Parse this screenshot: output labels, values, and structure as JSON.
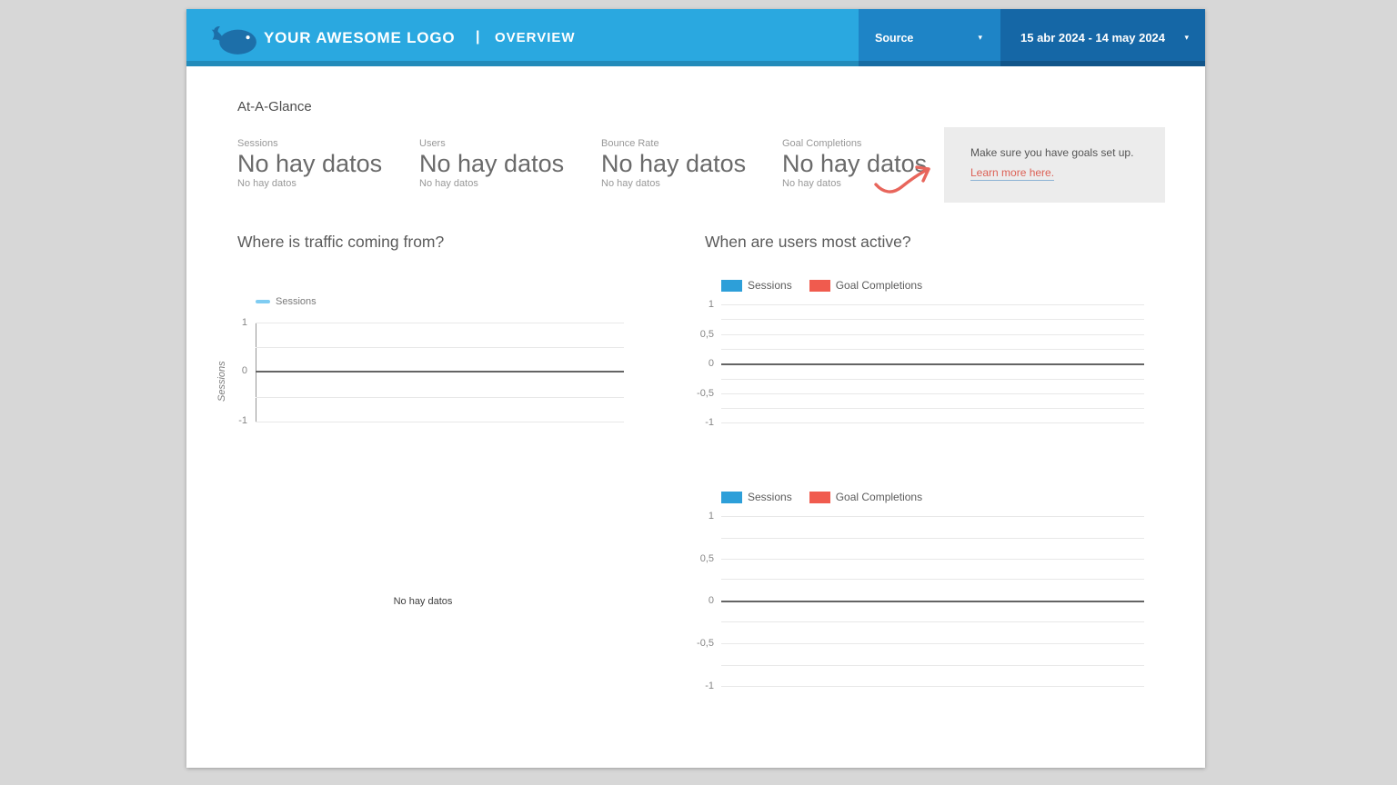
{
  "page": {
    "background_color": "#d7d7d7",
    "card_color": "#ffffff"
  },
  "header": {
    "logo_text": "YOUR AWESOME LOGO",
    "separator": "|",
    "page_title": "OVERVIEW",
    "source_filter": {
      "label": "Source",
      "caret": "▾"
    },
    "date_range": {
      "value": "15 abr 2024 - 14 may 2024",
      "caret": "▾"
    },
    "colors": {
      "bar": "#2aa8e0",
      "source_bg": "#1e84c6",
      "date_bg": "#1567a6",
      "logo": "#1d6fa9"
    }
  },
  "at_a_glance": {
    "title": "At-A-Glance",
    "metrics": [
      {
        "label": "Sessions",
        "value": "No hay datos",
        "sub": "No hay datos"
      },
      {
        "label": "Users",
        "value": "No hay datos",
        "sub": "No hay datos"
      },
      {
        "label": "Bounce Rate",
        "value": "No hay datos",
        "sub": "No hay datos"
      },
      {
        "label": "Goal Completions",
        "value": "No hay datos",
        "sub": "No hay datos"
      }
    ],
    "goals_note": {
      "message": "Make sure you have goals set up.",
      "link_text": "Learn more here.",
      "arrow_color": "#e8655b"
    }
  },
  "sections": {
    "traffic_title": "Where is traffic coming from?",
    "activity_title": "When are users most active?"
  },
  "chart_data": [
    {
      "id": "traffic-sources",
      "type": "line",
      "title": "Where is traffic coming from?",
      "state": "empty",
      "no_data_text": "No hay datos",
      "ylabel": "Sessions",
      "series": [
        {
          "name": "Sessions",
          "color": "#7fccf2",
          "values": []
        }
      ],
      "yticks": [
        "1",
        "0",
        "-1"
      ],
      "ylim": [
        -1,
        1
      ],
      "gridline_interval": 0.5,
      "grid": true,
      "legend_position": "top-left"
    },
    {
      "id": "activity-by-time-top",
      "type": "bar",
      "title": "When are users most active?",
      "state": "empty",
      "series": [
        {
          "name": "Sessions",
          "color": "#2d9fd9",
          "values": []
        },
        {
          "name": "Goal Completions",
          "color": "#f05b4e",
          "values": []
        }
      ],
      "yticks": [
        "1",
        "0,5",
        "0",
        "-0,5",
        "-1"
      ],
      "ylim": [
        -1,
        1
      ],
      "gridline_interval": 0.25,
      "grid": true,
      "legend_position": "top-left"
    },
    {
      "id": "activity-by-time-bottom",
      "type": "bar",
      "title": "When are users most active?",
      "state": "empty",
      "series": [
        {
          "name": "Sessions",
          "color": "#2d9fd9",
          "values": []
        },
        {
          "name": "Goal Completions",
          "color": "#f05b4e",
          "values": []
        }
      ],
      "yticks": [
        "1",
        "0,5",
        "0",
        "-0,5",
        "-1"
      ],
      "ylim": [
        -1,
        1
      ],
      "gridline_interval": 0.25,
      "grid": true,
      "legend_position": "top-left"
    }
  ]
}
